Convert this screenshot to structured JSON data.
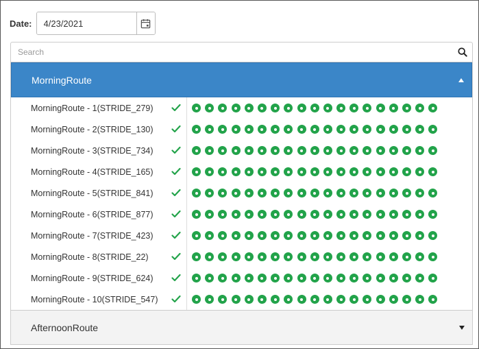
{
  "filter": {
    "date_label": "Date:",
    "date_value": "4/23/2021"
  },
  "search": {
    "placeholder": "Search"
  },
  "routes": [
    {
      "title": "MorningRoute",
      "expanded": true,
      "items": [
        {
          "label": "MorningRoute - 1(STRIDE_279)",
          "status": "check-icon",
          "stops": 19
        },
        {
          "label": "MorningRoute - 2(STRIDE_130)",
          "status": "check-icon",
          "stops": 19
        },
        {
          "label": "MorningRoute - 3(STRIDE_734)",
          "status": "check-icon",
          "stops": 19
        },
        {
          "label": "MorningRoute - 4(STRIDE_165)",
          "status": "check-icon",
          "stops": 19
        },
        {
          "label": "MorningRoute - 5(STRIDE_841)",
          "status": "check-icon",
          "stops": 19
        },
        {
          "label": "MorningRoute - 6(STRIDE_877)",
          "status": "check-icon",
          "stops": 19
        },
        {
          "label": "MorningRoute - 7(STRIDE_423)",
          "status": "check-icon",
          "stops": 19
        },
        {
          "label": "MorningRoute - 8(STRIDE_22)",
          "status": "check-icon",
          "stops": 19
        },
        {
          "label": "MorningRoute - 9(STRIDE_624)",
          "status": "check-icon",
          "stops": 19
        },
        {
          "label": "MorningRoute - 10(STRIDE_547)",
          "status": "check-icon",
          "stops": 19
        }
      ]
    },
    {
      "title": "AfternoonRoute",
      "expanded": false,
      "items": []
    }
  ],
  "colors": {
    "header_active": "#3b86c8",
    "stop_complete": "#22a34a",
    "check": "#22a34a"
  }
}
